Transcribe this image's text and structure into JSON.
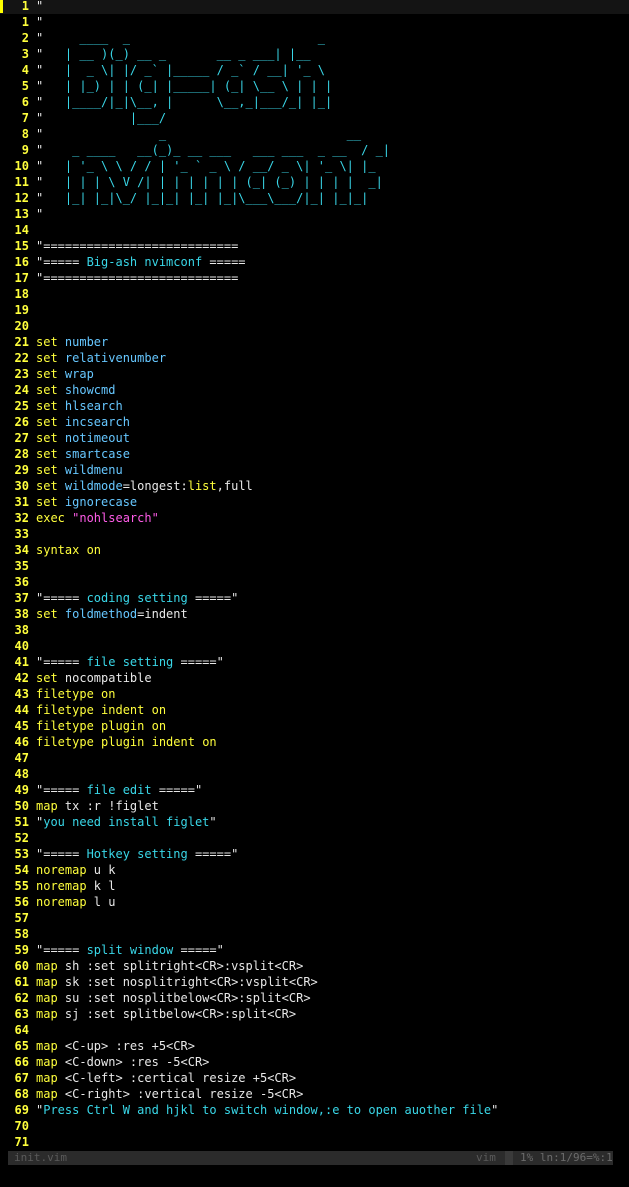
{
  "editor": {
    "cursor_line_number": "1",
    "lines": [
      {
        "n": "1",
        "tokens": [
          {
            "t": "\"",
            "c": "com"
          }
        ],
        "cursor": true
      },
      {
        "n": "1",
        "tokens": [
          {
            "t": "\"",
            "c": "com"
          }
        ]
      },
      {
        "n": "2",
        "tokens": [
          {
            "t": "\"",
            "c": "com"
          },
          {
            "t": "     ____  _                          _",
            "c": "cyan"
          }
        ]
      },
      {
        "n": "3",
        "tokens": [
          {
            "t": "\"",
            "c": "com"
          },
          {
            "t": "   | __ )(_) __ _       __ _ ___| |__",
            "c": "cyan"
          }
        ]
      },
      {
        "n": "4",
        "tokens": [
          {
            "t": "\"",
            "c": "com"
          },
          {
            "t": "   |  _ \\| |/ _` |_____ / _` / __| '_ \\",
            "c": "cyan"
          }
        ]
      },
      {
        "n": "5",
        "tokens": [
          {
            "t": "\"",
            "c": "com"
          },
          {
            "t": "   | |_) | | (_| |_____| (_| \\__ \\ | | |",
            "c": "cyan"
          }
        ]
      },
      {
        "n": "6",
        "tokens": [
          {
            "t": "\"",
            "c": "com"
          },
          {
            "t": "   |____/|_|\\__, |      \\__,_|___/_| |_|",
            "c": "cyan"
          }
        ]
      },
      {
        "n": "7",
        "tokens": [
          {
            "t": "\"",
            "c": "com"
          },
          {
            "t": "            |___/",
            "c": "cyan"
          }
        ]
      },
      {
        "n": "8",
        "tokens": [
          {
            "t": "\"",
            "c": "com"
          },
          {
            "t": "                _                         __",
            "c": "cyan"
          }
        ]
      },
      {
        "n": "9",
        "tokens": [
          {
            "t": "\"",
            "c": "com"
          },
          {
            "t": "    _ ____   __(_)_ __ ___   ___ ___  _ __  / _|",
            "c": "cyan"
          }
        ]
      },
      {
        "n": "10",
        "tokens": [
          {
            "t": "\"",
            "c": "com"
          },
          {
            "t": "   | '_ \\ \\ / / | '_ ` _ \\ / __/ _ \\| '_ \\| |_",
            "c": "cyan"
          }
        ]
      },
      {
        "n": "11",
        "tokens": [
          {
            "t": "\"",
            "c": "com"
          },
          {
            "t": "   | | | \\ V /| | | | | | | (_| (_) | | | |  _|",
            "c": "cyan"
          }
        ]
      },
      {
        "n": "12",
        "tokens": [
          {
            "t": "\"",
            "c": "com"
          },
          {
            "t": "   |_| |_|\\_/ |_|_| |_| |_|\\___\\___/|_| |_|_|",
            "c": "cyan"
          }
        ]
      },
      {
        "n": "13",
        "tokens": [
          {
            "t": "\"",
            "c": "com"
          }
        ]
      },
      {
        "n": "14",
        "tokens": []
      },
      {
        "n": "15",
        "tokens": [
          {
            "t": "\"===========================",
            "c": "com"
          }
        ]
      },
      {
        "n": "16",
        "tokens": [
          {
            "t": "\"===== ",
            "c": "com"
          },
          {
            "t": "Big-ash nvimconf",
            "c": "cyan"
          },
          {
            "t": " =====",
            "c": "com"
          }
        ]
      },
      {
        "n": "17",
        "tokens": [
          {
            "t": "\"===========================",
            "c": "com"
          }
        ]
      },
      {
        "n": "18",
        "tokens": []
      },
      {
        "n": "19",
        "tokens": []
      },
      {
        "n": "20",
        "tokens": []
      },
      {
        "n": "21",
        "tokens": [
          {
            "t": "set ",
            "c": "kw"
          },
          {
            "t": "number",
            "c": "opt"
          }
        ]
      },
      {
        "n": "22",
        "tokens": [
          {
            "t": "set ",
            "c": "kw"
          },
          {
            "t": "relativenumber",
            "c": "opt"
          }
        ]
      },
      {
        "n": "23",
        "tokens": [
          {
            "t": "set ",
            "c": "kw"
          },
          {
            "t": "wrap",
            "c": "opt"
          }
        ]
      },
      {
        "n": "24",
        "tokens": [
          {
            "t": "set ",
            "c": "kw"
          },
          {
            "t": "showcmd",
            "c": "opt"
          }
        ]
      },
      {
        "n": "25",
        "tokens": [
          {
            "t": "set ",
            "c": "kw"
          },
          {
            "t": "hlsearch",
            "c": "opt"
          }
        ]
      },
      {
        "n": "26",
        "tokens": [
          {
            "t": "set ",
            "c": "kw"
          },
          {
            "t": "incsearch",
            "c": "opt"
          }
        ]
      },
      {
        "n": "27",
        "tokens": [
          {
            "t": "set ",
            "c": "kw"
          },
          {
            "t": "notimeout",
            "c": "opt"
          }
        ]
      },
      {
        "n": "28",
        "tokens": [
          {
            "t": "set ",
            "c": "kw"
          },
          {
            "t": "smartcase",
            "c": "opt"
          }
        ]
      },
      {
        "n": "29",
        "tokens": [
          {
            "t": "set ",
            "c": "kw"
          },
          {
            "t": "wildmenu",
            "c": "opt"
          }
        ]
      },
      {
        "n": "30",
        "tokens": [
          {
            "t": "set ",
            "c": "kw"
          },
          {
            "t": "wildmode",
            "c": "opt"
          },
          {
            "t": "=longest:",
            "c": "plain"
          },
          {
            "t": "list",
            "c": "kw"
          },
          {
            "t": ",full",
            "c": "plain"
          }
        ]
      },
      {
        "n": "31",
        "tokens": [
          {
            "t": "set ",
            "c": "kw"
          },
          {
            "t": "ignorecase",
            "c": "opt"
          }
        ]
      },
      {
        "n": "32",
        "tokens": [
          {
            "t": "exec ",
            "c": "kw"
          },
          {
            "t": "\"nohlsearch\"",
            "c": "str"
          }
        ]
      },
      {
        "n": "33",
        "tokens": []
      },
      {
        "n": "34",
        "tokens": [
          {
            "t": "syntax ",
            "c": "kw"
          },
          {
            "t": "on",
            "c": "on"
          }
        ]
      },
      {
        "n": "35",
        "tokens": []
      },
      {
        "n": "36",
        "tokens": []
      },
      {
        "n": "37",
        "tokens": [
          {
            "t": "\"===== ",
            "c": "com"
          },
          {
            "t": "coding setting",
            "c": "cyan"
          },
          {
            "t": " =====\"",
            "c": "com"
          }
        ]
      },
      {
        "n": "38",
        "tokens": [
          {
            "t": "set ",
            "c": "kw"
          },
          {
            "t": "foldmethod",
            "c": "opt"
          },
          {
            "t": "=indent",
            "c": "plain"
          }
        ]
      },
      {
        "n": "38",
        "tokens": []
      },
      {
        "n": "40",
        "tokens": []
      },
      {
        "n": "41",
        "tokens": [
          {
            "t": "\"===== ",
            "c": "com"
          },
          {
            "t": "file setting",
            "c": "cyan"
          },
          {
            "t": " =====\"",
            "c": "com"
          }
        ]
      },
      {
        "n": "42",
        "tokens": [
          {
            "t": "set ",
            "c": "kw"
          },
          {
            "t": "nocompatible",
            "c": "plain"
          }
        ]
      },
      {
        "n": "43",
        "tokens": [
          {
            "t": "filetype ",
            "c": "kw"
          },
          {
            "t": "on",
            "c": "on"
          }
        ]
      },
      {
        "n": "44",
        "tokens": [
          {
            "t": "filetype ",
            "c": "kw"
          },
          {
            "t": "indent ",
            "c": "kw"
          },
          {
            "t": "on",
            "c": "on"
          }
        ]
      },
      {
        "n": "45",
        "tokens": [
          {
            "t": "filetype ",
            "c": "kw"
          },
          {
            "t": "plugin ",
            "c": "kw"
          },
          {
            "t": "on",
            "c": "on"
          }
        ]
      },
      {
        "n": "46",
        "tokens": [
          {
            "t": "filetype ",
            "c": "kw"
          },
          {
            "t": "plugin ",
            "c": "kw"
          },
          {
            "t": "indent ",
            "c": "kw"
          },
          {
            "t": "on",
            "c": "on"
          }
        ]
      },
      {
        "n": "47",
        "tokens": []
      },
      {
        "n": "48",
        "tokens": []
      },
      {
        "n": "49",
        "tokens": [
          {
            "t": "\"===== ",
            "c": "com"
          },
          {
            "t": "file edit",
            "c": "cyan"
          },
          {
            "t": " =====\"",
            "c": "com"
          }
        ]
      },
      {
        "n": "50",
        "tokens": [
          {
            "t": "map ",
            "c": "kw"
          },
          {
            "t": "tx :r !figlet",
            "c": "plain"
          }
        ]
      },
      {
        "n": "51",
        "tokens": [
          {
            "t": "\"",
            "c": "com"
          },
          {
            "t": "you need install figlet",
            "c": "cyan"
          },
          {
            "t": "\"",
            "c": "com"
          }
        ]
      },
      {
        "n": "52",
        "tokens": []
      },
      {
        "n": "53",
        "tokens": [
          {
            "t": "\"===== ",
            "c": "com"
          },
          {
            "t": "Hotkey setting",
            "c": "cyan"
          },
          {
            "t": " =====\"",
            "c": "com"
          }
        ]
      },
      {
        "n": "54",
        "tokens": [
          {
            "t": "noremap ",
            "c": "kw"
          },
          {
            "t": "u k",
            "c": "plain"
          }
        ]
      },
      {
        "n": "55",
        "tokens": [
          {
            "t": "noremap ",
            "c": "kw"
          },
          {
            "t": "k l",
            "c": "plain"
          }
        ]
      },
      {
        "n": "56",
        "tokens": [
          {
            "t": "noremap ",
            "c": "kw"
          },
          {
            "t": "l u",
            "c": "plain"
          }
        ]
      },
      {
        "n": "57",
        "tokens": []
      },
      {
        "n": "58",
        "tokens": []
      },
      {
        "n": "59",
        "tokens": [
          {
            "t": "\"===== ",
            "c": "com"
          },
          {
            "t": "split window",
            "c": "cyan"
          },
          {
            "t": " =====\"",
            "c": "com"
          }
        ]
      },
      {
        "n": "60",
        "tokens": [
          {
            "t": "map ",
            "c": "kw"
          },
          {
            "t": "sh :set splitright<CR>:vsplit<CR>",
            "c": "plain"
          }
        ]
      },
      {
        "n": "61",
        "tokens": [
          {
            "t": "map ",
            "c": "kw"
          },
          {
            "t": "sk :set nosplitright<CR>:vsplit<CR>",
            "c": "plain"
          }
        ]
      },
      {
        "n": "62",
        "tokens": [
          {
            "t": "map ",
            "c": "kw"
          },
          {
            "t": "su :set nosplitbelow<CR>:split<CR>",
            "c": "plain"
          }
        ]
      },
      {
        "n": "63",
        "tokens": [
          {
            "t": "map ",
            "c": "kw"
          },
          {
            "t": "sj :set splitbelow<CR>:split<CR>",
            "c": "plain"
          }
        ]
      },
      {
        "n": "64",
        "tokens": []
      },
      {
        "n": "65",
        "tokens": [
          {
            "t": "map ",
            "c": "kw"
          },
          {
            "t": "<C-up> :res +5<CR>",
            "c": "plain"
          }
        ]
      },
      {
        "n": "66",
        "tokens": [
          {
            "t": "map ",
            "c": "kw"
          },
          {
            "t": "<C-down> :res -5<CR>",
            "c": "plain"
          }
        ]
      },
      {
        "n": "67",
        "tokens": [
          {
            "t": "map ",
            "c": "kw"
          },
          {
            "t": "<C-left> :certical resize +5<CR>",
            "c": "plain"
          }
        ]
      },
      {
        "n": "68",
        "tokens": [
          {
            "t": "map ",
            "c": "kw"
          },
          {
            "t": "<C-right> :vertical resize -5<CR>",
            "c": "plain"
          }
        ]
      },
      {
        "n": "69",
        "tokens": [
          {
            "t": "\"",
            "c": "com"
          },
          {
            "t": "Press Ctrl W and hjkl to switch window,:e to open auother file",
            "c": "cyan"
          },
          {
            "t": "\"",
            "c": "com"
          }
        ]
      },
      {
        "n": "70",
        "tokens": []
      },
      {
        "n": "71",
        "tokens": []
      }
    ]
  },
  "statusline": {
    "filename": "init.vim",
    "filetype": "vim",
    "position": "1%  ln:1/96=%:1"
  },
  "colors": {
    "background": "#000000",
    "line_number": "#ffff3c",
    "keyword": "#ffff3c",
    "option": "#66c7ff",
    "string": "#ff5ce8",
    "comment_text": "#39d7e8",
    "statusline_bg": "#2b2b2b"
  }
}
